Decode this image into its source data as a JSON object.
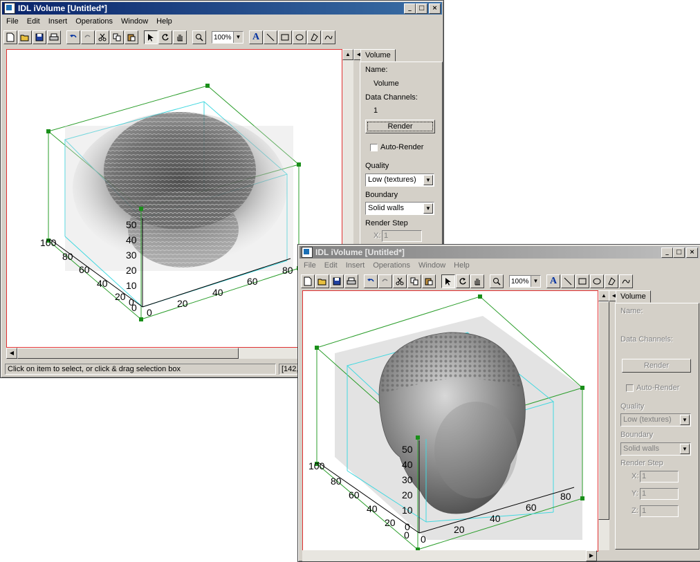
{
  "windows": [
    {
      "title": "IDL iVolume [Untitled*]",
      "menu": [
        "File",
        "Edit",
        "Insert",
        "Operations",
        "Window",
        "Help"
      ],
      "zoom": "100%",
      "panel": {
        "tab": "Volume",
        "name_label": "Name:",
        "name_value": "Volume",
        "channels_label": "Data Channels:",
        "channels_value": "1",
        "render_button": "Render",
        "auto_render": "Auto-Render",
        "quality_label": "Quality",
        "quality_value": "Low (textures)",
        "boundary_label": "Boundary",
        "boundary_value": "Solid walls",
        "render_step_label": "Render Step",
        "x_label": "X:",
        "x_value": "1"
      },
      "status": {
        "message": "Click on item to select, or click & drag selection box",
        "coords": "[142,"
      },
      "axes": {
        "x_ticks": [
          "0",
          "20",
          "40",
          "60",
          "80"
        ],
        "y_ticks": [
          "0",
          "20",
          "40",
          "60",
          "80",
          "100"
        ],
        "z_ticks": [
          "0",
          "10",
          "20",
          "30",
          "40",
          "50"
        ]
      }
    },
    {
      "title": "IDL iVolume [Untitled*]",
      "menu": [
        "File",
        "Edit",
        "Insert",
        "Operations",
        "Window",
        "Help"
      ],
      "zoom": "100%",
      "panel": {
        "tab": "Volume",
        "name_label": "Name:",
        "channels_label": "Data Channels:",
        "render_button": "Render",
        "auto_render": "Auto-Render",
        "quality_label": "Quality",
        "quality_value": "Low (textures)",
        "boundary_label": "Boundary",
        "boundary_value": "Solid walls",
        "render_step_label": "Render Step",
        "x_label": "X:",
        "x_value": "1",
        "y_label": "Y:",
        "y_value": "1",
        "z_label": "Z:",
        "z_value": "1"
      },
      "axes": {
        "x_ticks": [
          "0",
          "20",
          "40",
          "60",
          "80"
        ],
        "y_ticks": [
          "0",
          "20",
          "40",
          "60",
          "80",
          "100"
        ],
        "z_ticks": [
          "0",
          "10",
          "20",
          "30",
          "40",
          "50"
        ]
      }
    }
  ],
  "colors": {
    "cube_edge": "#2a9d2a",
    "inner_box": "#40d8e0",
    "node": "#1a8f1a",
    "canvas_border": "#e03030"
  }
}
